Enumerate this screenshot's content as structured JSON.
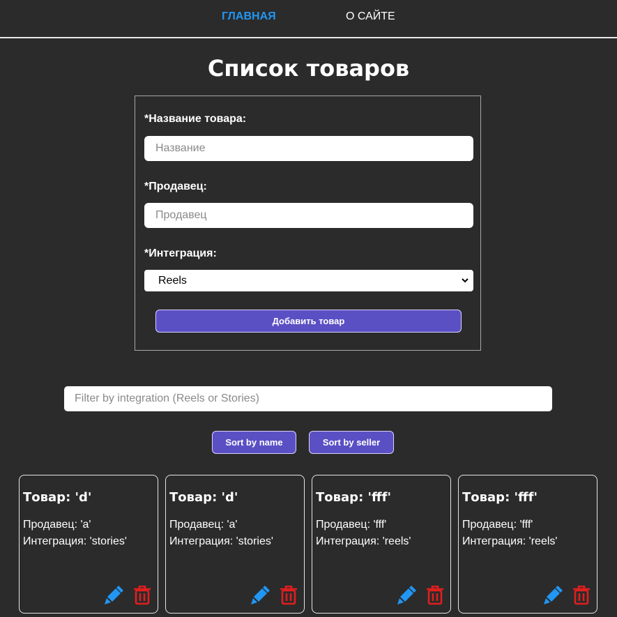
{
  "nav": {
    "home": "ГЛАВНАЯ",
    "about": "О САЙТЕ"
  },
  "page_title": "Список товаров",
  "form": {
    "name_label": "*Название товара:",
    "name_placeholder": "Название",
    "seller_label": "*Продавец:",
    "seller_placeholder": "Продавец",
    "integration_label": "*Интеграция:",
    "integration_selected": "Reels",
    "add_button": "Добавить товар"
  },
  "filter": {
    "placeholder": "Filter by integration (Reels or Stories)"
  },
  "sort": {
    "by_name": "Sort by name",
    "by_seller": "Sort by seller"
  },
  "cards": [
    {
      "title": "Товар: 'd'",
      "seller": "Продавец: 'a'",
      "integration": "Интеграция: 'stories'"
    },
    {
      "title": "Товар: 'd'",
      "seller": "Продавец: 'a'",
      "integration": "Интеграция: 'stories'"
    },
    {
      "title": "Товар: 'fff'",
      "seller": "Продавец: 'fff'",
      "integration": "Интеграция: 'reels'"
    },
    {
      "title": "Товар: 'fff'",
      "seller": "Продавец: 'fff'",
      "integration": "Интеграция: 'reels'"
    }
  ],
  "icons": {
    "edit": "pen-icon",
    "delete": "trash-icon"
  },
  "colors": {
    "accent": "#2196f3",
    "button": "#5b4fc4",
    "delete": "#e01e1e",
    "background": "#2b2b2b"
  }
}
